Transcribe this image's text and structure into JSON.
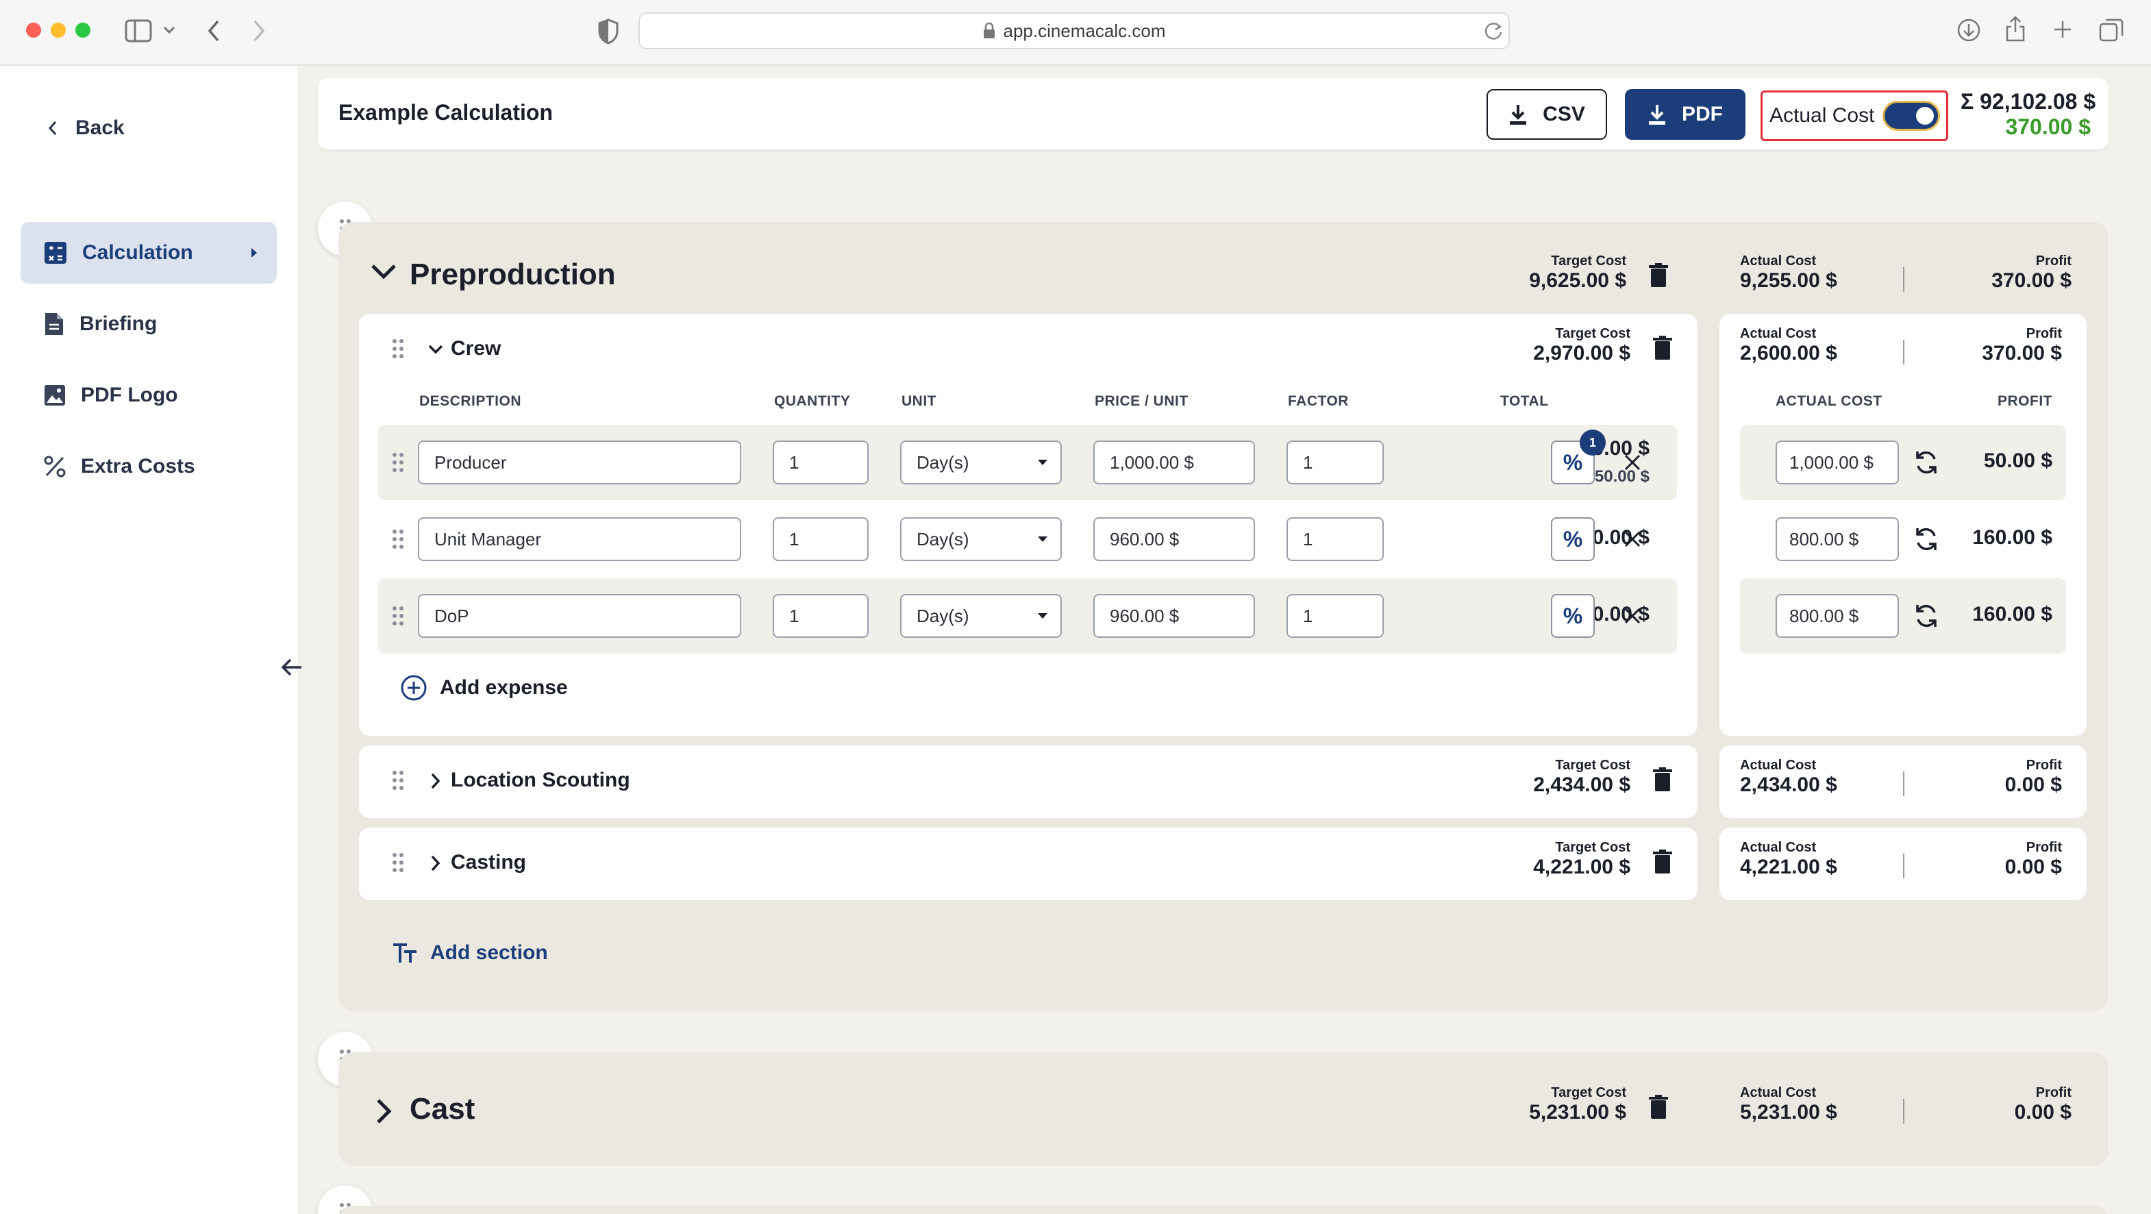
{
  "browser": {
    "url": "app.cinemacalc.com"
  },
  "sidebar": {
    "back_label": "Back",
    "items": [
      {
        "label": "Calculation",
        "icon": "calculator-icon",
        "active": true
      },
      {
        "label": "Briefing",
        "icon": "document-icon"
      },
      {
        "label": "PDF Logo",
        "icon": "image-icon"
      },
      {
        "label": "Extra Costs",
        "icon": "percent-icon"
      }
    ]
  },
  "header": {
    "title": "Example Calculation",
    "csv_label": "CSV",
    "pdf_label": "PDF",
    "actual_cost_label": "Actual Cost",
    "actual_cost_toggle_on": true,
    "sum_symbol": "Σ",
    "sum_total": "92,102.08 $",
    "sum_profit": "370.00 $"
  },
  "labels": {
    "target_cost": "Target Cost",
    "actual_cost": "Actual Cost",
    "profit": "Profit",
    "col_description": "DESCRIPTION",
    "col_quantity": "QUANTITY",
    "col_unit": "UNIT",
    "col_price": "PRICE / UNIT",
    "col_factor": "FACTOR",
    "col_total": "TOTAL",
    "col_actual_cost": "ACTUAL COST",
    "col_profit": "PROFIT",
    "add_expense": "Add expense",
    "add_section": "Add section"
  },
  "preproduction": {
    "title": "Preproduction",
    "target": "9,625.00 $",
    "actual": "9,255.00 $",
    "profit": "370.00 $",
    "crew": {
      "title": "Crew",
      "target": "2,970.00 $",
      "actual": "2,600.00 $",
      "profit": "370.00 $",
      "rows": [
        {
          "description": "Producer",
          "quantity": "1",
          "unit": "Day(s)",
          "price": "1,000.00 $",
          "factor": "1",
          "total": "1,000.00 $",
          "extra": "+ 50.00 $",
          "badge": "1",
          "actual": "1,000.00 $",
          "profit": "50.00 $"
        },
        {
          "description": "Unit Manager",
          "quantity": "1",
          "unit": "Day(s)",
          "price": "960.00 $",
          "factor": "1",
          "total": "960.00 $",
          "actual": "800.00 $",
          "profit": "160.00 $"
        },
        {
          "description": "DoP",
          "quantity": "1",
          "unit": "Day(s)",
          "price": "960.00 $",
          "factor": "1",
          "total": "960.00 $",
          "actual": "800.00 $",
          "profit": "160.00 $"
        }
      ]
    },
    "location": {
      "title": "Location Scouting",
      "target": "2,434.00 $",
      "actual": "2,434.00 $",
      "profit": "0.00 $"
    },
    "casting": {
      "title": "Casting",
      "target": "4,221.00 $",
      "actual": "4,221.00 $",
      "profit": "0.00 $"
    }
  },
  "cast": {
    "title": "Cast",
    "target": "5,231.00 $",
    "actual": "5,231.00 $",
    "profit": "0.00 $"
  },
  "colors": {
    "brand": "#1b3d7a",
    "profit_green": "#3a9a2a",
    "toggle_outline": "#e0303a"
  }
}
